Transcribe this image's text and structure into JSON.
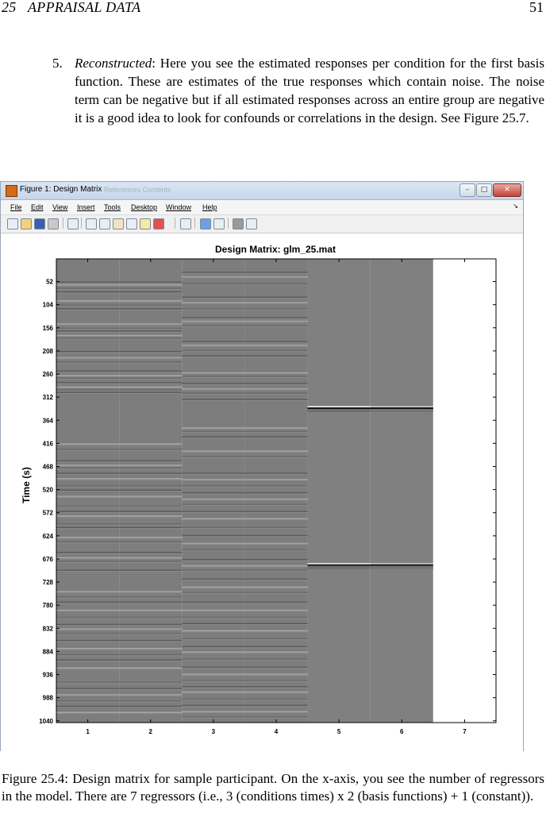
{
  "header": {
    "chapter": "25",
    "section": "APPRAISAL DATA",
    "page": "51"
  },
  "item": {
    "number": "5.",
    "term": "Reconstructed",
    "text": ": Here you see the estimated responses per condition for the first basis function. These are estimates of the true responses which contain noise. The noise term can be negative but if all estimated responses across an entire group are negative it is a good idea to look for confounds or correlations in the design. See Figure 25.7."
  },
  "window": {
    "title": "Figure 1: Design Matrix",
    "ghost_text": "References   Contents",
    "buttons": {
      "minimize": "–",
      "maximize": "□",
      "close": "✕"
    },
    "menus": [
      "File",
      "Edit",
      "View",
      "Insert",
      "Tools",
      "Desktop",
      "Window",
      "Help"
    ],
    "toolbar_icons": [
      "new-file-icon",
      "open-folder-icon",
      "save-icon",
      "print-icon",
      "pointer-icon",
      "zoom-in-icon",
      "zoom-out-icon",
      "pan-icon",
      "rotate-icon",
      "data-cursor-icon",
      "brush-icon",
      "link-icon",
      "colorbar-icon",
      "legend-icon",
      "hide-tools-icon",
      "show-tools-icon"
    ]
  },
  "chart_data": {
    "type": "heatmap",
    "title": "Design Matrix: glm_25.mat",
    "ylabel": "Time (s)",
    "xlabel": "",
    "x_ticks": [
      "1",
      "2",
      "3",
      "4",
      "5",
      "6",
      "7"
    ],
    "y_ticks": [
      "52",
      "104",
      "156",
      "208",
      "260",
      "312",
      "364",
      "416",
      "468",
      "520",
      "572",
      "624",
      "676",
      "728",
      "780",
      "832",
      "884",
      "936",
      "988",
      "1040"
    ],
    "ylim": [
      1,
      1044
    ],
    "columns": [
      {
        "regressor": 1,
        "value_color": "#7d7d7d"
      },
      {
        "regressor": 2,
        "value_color": "#7d7d7d"
      },
      {
        "regressor": 3,
        "value_color": "#7d7d7d"
      },
      {
        "regressor": 4,
        "value_color": "#7d7d7d"
      },
      {
        "regressor": 5,
        "value_color": "#808080",
        "events_at": [
          335,
          688
        ]
      },
      {
        "regressor": 6,
        "value_color": "#808080",
        "events_at": [
          335,
          688
        ]
      },
      {
        "regressor": 7,
        "value_color": "#ffffff",
        "constant": true
      }
    ],
    "stripe_times": {
      "col12": [
        52,
        58,
        66,
        74,
        94,
        104,
        112,
        146,
        156,
        162,
        172,
        178,
        208,
        222,
        232,
        252,
        262,
        268,
        278,
        288,
        294,
        300,
        416,
        428,
        454,
        464,
        470,
        482,
        494,
        510,
        520,
        534,
        556,
        568,
        578,
        596,
        604,
        626,
        636,
        660,
        672,
        680,
        700,
        748,
        760,
        772,
        790,
        806,
        822,
        832,
        842,
        858,
        876,
        890,
        902,
        920,
        952,
        966,
        980,
        994,
        1006,
        1020
      ],
      "col34": [
        30,
        40,
        56,
        86,
        98,
        112,
        132,
        140,
        150,
        186,
        194,
        206,
        218,
        256,
        264,
        280,
        292,
        302,
        316,
        380,
        388,
        400,
        432,
        444,
        482,
        496,
        510,
        526,
        540,
        552,
        568,
        584,
        604,
        622,
        640,
        654,
        676,
        690,
        700,
        720,
        738,
        750,
        772,
        790,
        806,
        820,
        836,
        854,
        872,
        884,
        900,
        918,
        934,
        948,
        962,
        974,
        990,
        1004,
        1018,
        1030
      ]
    }
  },
  "caption": {
    "label": "Figure 25.4:",
    "text": "Design matrix for sample participant. On the x-axis, you see the number of regressors in the model. There are 7 regressors (i.e., 3 (conditions times) x 2 (basis functions) + 1 (constant))."
  }
}
